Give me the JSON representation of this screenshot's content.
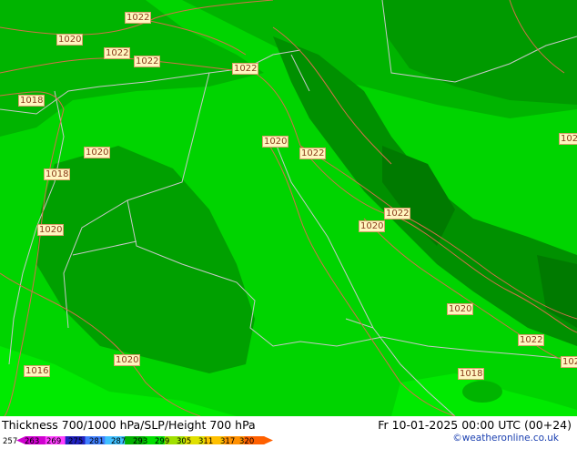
{
  "footer": {
    "title": "Thickness 700/1000 hPa/SLP/Height 700 hPa",
    "datetime": "Fr 10-01-2025 00:00 UTC (00+24)",
    "credit": "©weatheronline.co.uk"
  },
  "colors": {
    "light_green": "#00d400",
    "mid_green": "#00b400",
    "dark_green": "#009a00",
    "bright_green": "#00f000",
    "contour": "#d2704a",
    "border": "#c8c8c8"
  },
  "scale": {
    "ticks": [
      "257",
      "263",
      "269",
      "275",
      "281",
      "287",
      "293",
      "299",
      "305",
      "311",
      "317",
      "320"
    ],
    "colors": [
      "#d000d0",
      "#ff40ff",
      "#2020c0",
      "#4080ff",
      "#40c0ff",
      "#00b000",
      "#00e000",
      "#a0e000",
      "#e0e000",
      "#ffc000",
      "#ff9000",
      "#ff6000"
    ]
  },
  "isobar_labels": [
    {
      "text": "1022",
      "pos": "0"
    },
    {
      "text": "1020",
      "pos": "1"
    },
    {
      "text": "1022",
      "pos": "2"
    },
    {
      "text": "1022",
      "pos": "3"
    },
    {
      "text": "1022",
      "pos": "4"
    },
    {
      "text": "1018",
      "pos": "5"
    },
    {
      "text": "1020",
      "pos": "6"
    },
    {
      "text": "1020",
      "pos": "7"
    },
    {
      "text": "1022",
      "pos": "8"
    },
    {
      "text": "1018",
      "pos": "9"
    },
    {
      "text": "1020",
      "pos": "10"
    },
    {
      "text": "1022",
      "pos": "11"
    },
    {
      "text": "1020",
      "pos": "12"
    },
    {
      "text": "1020",
      "pos": "13"
    },
    {
      "text": "1022",
      "pos": "14"
    },
    {
      "text": "1020",
      "pos": "15"
    },
    {
      "text": "1016",
      "pos": "16"
    },
    {
      "text": "1018",
      "pos": "17"
    },
    {
      "text": "102",
      "pos": "18"
    },
    {
      "text": "102",
      "pos": "19"
    }
  ]
}
